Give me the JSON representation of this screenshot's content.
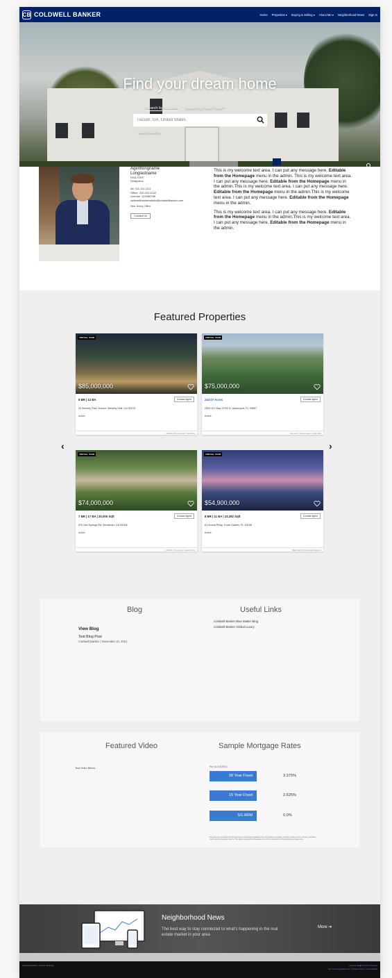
{
  "brand": {
    "name": "COLDWELL BANKER",
    "mark": "CB",
    "color": "#012169"
  },
  "nav": [
    "Home",
    "Properties ▾",
    "Buying & Selling ▾",
    "About Me ▾",
    "Neighborhood News",
    "Sign In"
  ],
  "hero": {
    "title": "Find your dream home",
    "tabs": [
      "Search by Location",
      "Search by Drive Time™"
    ],
    "search_placeholder": "Tucson, GA, United States",
    "search_near": "Search near me",
    "slides": 3,
    "active_slide": 2
  },
  "agent": {
    "first_name": "Agentlongname",
    "last_name": "Longlastname",
    "title": "REALTOR®",
    "designation": "Designation",
    "alt_phone": "Alt: 111.111.1111",
    "office_phone": "Office: 222.222.2222",
    "license": "License: 123456789",
    "email": "coldwellbankeradmin@coldwellbanker.com",
    "office": "New Jersey Office",
    "contact_label": "Contact Us"
  },
  "welcome": {
    "p1_a": "This is my welcome text area. I can put any message here. ",
    "p1_b": "Editable from the Homepage",
    "p1_c": " menu in the admin. This is my welcome text area. I can put any message here. ",
    "p1_d": "Editable from the Homepage",
    "p1_e": " menu in the admin.This is my welcome text area. I can put any message here. ",
    "p1_f": "Editable from the Homepage",
    "p1_g": " menu in the admin.This is my welcome text area. I can put any message here. ",
    "p1_h": "Editable from the Homepage",
    "p1_i": " menu in the admin.",
    "p2_a": "This is my welcome text area. I can put any message here. ",
    "p2_b": "Editable from the Homepage",
    "p2_c": " menu in the admin.This is my welcome text area. I can put any message here. ",
    "p2_d": "Editable from the Homepage",
    "p2_e": " menu in the admin."
  },
  "featured": {
    "title": "Featured Properties",
    "badge": "VIRTUAL TOUR",
    "contact_label": "Contact Agent",
    "cards": [
      {
        "price": "$85,000,000",
        "specs": "8 BR | 12 BA",
        "address": "20 Beverly Park Terrace, Beverly Hills, CA 90210",
        "status": "Active",
        "footer": "CRMLS | Beverly Hills | Sold Mkts"
      },
      {
        "price": "$75,000,000",
        "specs": "243.07 Acres",
        "address": "2300 US Hwy 17/92 N, Davenport, FL 33837",
        "status": "Active",
        "footer": "SteLLAR | Winter Haven / Polk Mkts"
      },
      {
        "price": "$74,000,000",
        "specs": "7 BR | 17 BA | 20,000 Sqft",
        "address": "670 Hot Springs Rd, Montecito, CA 93108",
        "status": "Active",
        "footer": "CRMLS | Montecito | Coastal MLS"
      },
      {
        "price": "$54,900,000",
        "specs": "8 BR | 11 BA | 23,282 Sqft",
        "address": "81 Arvida Pkwy, Coral Gables, FL 33156",
        "status": "Active",
        "footer": "BEACHES | Miami-Dade Realtors"
      }
    ]
  },
  "blog": {
    "title": "Blog",
    "view": "View Blog",
    "post": "Test Blog Post",
    "meta": "Coldwell Banker | November 10, 2021"
  },
  "links": {
    "title": "Useful Links",
    "items": [
      "Coldwell Banker Blue Matter Blog",
      "Coldwell Banker Global Luxury"
    ]
  },
  "video": {
    "title": "Featured Video",
    "text": "Test Video Below"
  },
  "mortgage": {
    "title": "Sample Mortgage Rates",
    "date": "For 11/10/2021",
    "rates": [
      {
        "label": "30 Year Fixed",
        "value": "3.375%"
      },
      {
        "label": "15 Year Fixed",
        "value": "2.625%"
      },
      {
        "label": "5/1 ARM",
        "value": "0.0%"
      }
    ],
    "disclaimer": "The rates are provided for reference only. Actual rates available may vary based on location, lending, closing costs, property condition, credit history and other factors. This data is provided by Bankrate.com and is intended for informational purposes only."
  },
  "news": {
    "title": "Neighborhood News",
    "text": "The best way to stay connected to what's happening in the real estate market in your area",
    "more": "More ➔"
  },
  "footer": {
    "left": "Coldwell Banker | Cookie Settings",
    "right_1": "Contact Us  ▶  Terms of Service",
    "right_2": "Fair Housing Statement | Privacy Policy | Accessibility"
  }
}
